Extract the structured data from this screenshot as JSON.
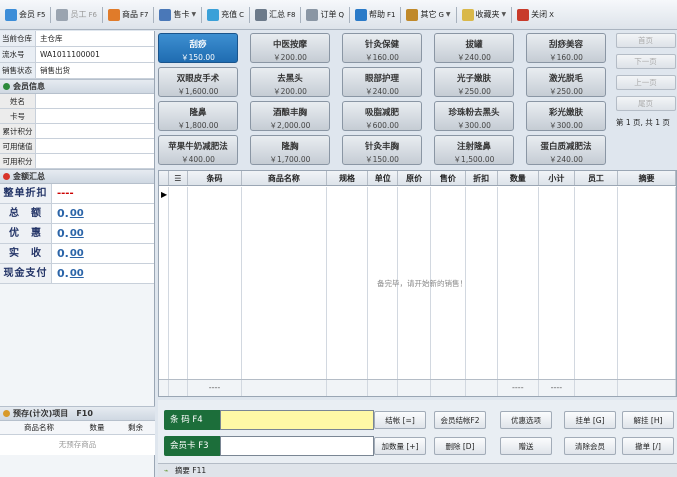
{
  "toolbar": {
    "items": [
      {
        "label": "会员",
        "key": "F5",
        "icon": "member-icon",
        "color": "#3c8dd8",
        "arrow": false,
        "disabled": false
      },
      {
        "label": "员工",
        "key": "F6",
        "icon": "staff-icon",
        "color": "#9aa4b0",
        "arrow": false,
        "disabled": true
      },
      {
        "label": "商品",
        "key": "F7",
        "icon": "goods-icon",
        "color": "#e07b2a",
        "arrow": false,
        "disabled": false
      },
      {
        "label": "售卡",
        "key": "",
        "icon": "sell-card-icon",
        "color": "#4a78b8",
        "arrow": true,
        "disabled": false
      },
      {
        "label": "充值",
        "key": "C",
        "icon": "recharge-icon",
        "color": "#3aa0d8",
        "arrow": false,
        "disabled": false
      },
      {
        "label": "汇总",
        "key": "F8",
        "icon": "summary-icon",
        "color": "#6c7a8a",
        "arrow": false,
        "disabled": false
      },
      {
        "label": "订单",
        "key": "Q",
        "icon": "order-icon",
        "color": "#8a96a4",
        "arrow": false,
        "disabled": false
      },
      {
        "label": "帮助",
        "key": "F1",
        "icon": "help-icon",
        "color": "#2a7ac8",
        "arrow": false,
        "disabled": false
      },
      {
        "label": "其它",
        "key": "G",
        "icon": "other-icon",
        "color": "#c0892a",
        "arrow": true,
        "disabled": false
      },
      {
        "label": "收藏夹",
        "key": "",
        "icon": "favorites-icon",
        "color": "#d9b84a",
        "arrow": true,
        "disabled": false
      },
      {
        "label": "关闭",
        "key": "X",
        "icon": "close-icon",
        "color": "#c83a2a",
        "arrow": false,
        "disabled": false
      }
    ]
  },
  "store": {
    "rows": [
      {
        "label": "当前仓库",
        "value": "主仓库"
      },
      {
        "label": "流水号",
        "value": "WA1011100001"
      },
      {
        "label": "销售状态",
        "value": "销售出货"
      }
    ]
  },
  "member": {
    "title": "会员信息",
    "mark_color": "#2c8a3c",
    "rows": [
      "姓名",
      "卡号",
      "累计积分",
      "可用储值",
      "可用积分"
    ]
  },
  "amounts": {
    "title": "金额汇总",
    "mark_color": "#d8342a",
    "rows": [
      {
        "label": "整单折扣",
        "int": "----",
        "dec": "",
        "is_discount": true
      },
      {
        "label": "总　额",
        "int": "0.",
        "dec": "00",
        "is_discount": false
      },
      {
        "label": "优　惠",
        "int": "0.",
        "dec": "00",
        "is_discount": false
      },
      {
        "label": "实　收",
        "int": "0.",
        "dec": "00",
        "is_discount": false
      },
      {
        "label": "现金支付",
        "int": "0.",
        "dec": "00",
        "is_discount": false
      }
    ]
  },
  "preorder": {
    "title": "预存(计次)项目",
    "key": "F10",
    "columns": [
      "商品名称",
      "数量",
      "剩余"
    ],
    "empty": "无预存商品"
  },
  "services": [
    {
      "name": "刮痧",
      "price": "￥150.00",
      "active": true
    },
    {
      "name": "中医按摩",
      "price": "￥200.00",
      "active": false
    },
    {
      "name": "针灸保健",
      "price": "￥160.00",
      "active": false
    },
    {
      "name": "拔罐",
      "price": "￥240.00",
      "active": false
    },
    {
      "name": "刮痧美容",
      "price": "￥160.00",
      "active": false
    },
    {
      "name": "双眼皮手术",
      "price": "￥1,600.00",
      "active": false
    },
    {
      "name": "去黑头",
      "price": "￥200.00",
      "active": false
    },
    {
      "name": "眼部护理",
      "price": "￥240.00",
      "active": false
    },
    {
      "name": "光子嫩肤",
      "price": "￥250.00",
      "active": false
    },
    {
      "name": "激光脱毛",
      "price": "￥250.00",
      "active": false
    },
    {
      "name": "隆鼻",
      "price": "￥1,800.00",
      "active": false
    },
    {
      "name": "酒酿丰胸",
      "price": "￥2,000.00",
      "active": false
    },
    {
      "name": "吸脂减肥",
      "price": "￥600.00",
      "active": false
    },
    {
      "name": "珍珠粉去黑头",
      "price": "￥300.00",
      "active": false
    },
    {
      "name": "彩光嫩肤",
      "price": "￥300.00",
      "active": false
    },
    {
      "name": "苹果牛奶减肥法",
      "price": "￥400.00",
      "active": false
    },
    {
      "name": "隆胸",
      "price": "￥1,700.00",
      "active": false
    },
    {
      "name": "针灸丰胸",
      "price": "￥150.00",
      "active": false
    },
    {
      "name": "注射隆鼻",
      "price": "￥1,500.00",
      "active": false
    },
    {
      "name": "蛋白质减肥法",
      "price": "￥240.00",
      "active": false
    }
  ],
  "pager": {
    "buttons": [
      "首页",
      "下一页",
      "上一页",
      "尾页"
    ],
    "info": "第 1 页, 共 1 页"
  },
  "table": {
    "columns": [
      "☰",
      "条码",
      "商品名称",
      "规格",
      "单位",
      "原价",
      "售价",
      "折扣",
      "数量",
      "小计",
      "员工",
      "摘要"
    ],
    "footer": [
      "",
      "----",
      "",
      "",
      "",
      "",
      "",
      "",
      "----",
      "----",
      "",
      ""
    ],
    "empty_message": "备完毕，请开始新的销售！"
  },
  "entry": {
    "barcode_label": "条 码 F4",
    "member_label": "会员卡 F3",
    "barcode_color": "#fff9a6"
  },
  "actions": [
    {
      "label": "结帐 [=]"
    },
    {
      "label": "会员结帐F2"
    },
    {
      "label": "优惠选项"
    },
    {
      "label": "挂单 [G]"
    },
    {
      "label": "解挂 [H]"
    },
    {
      "label": "加数量 [+]"
    },
    {
      "label": "删除 [D]"
    },
    {
      "label": "赠送"
    },
    {
      "label": "清除会员"
    },
    {
      "label": "撤单 [/]"
    }
  ],
  "status": {
    "text": "摘要 F11"
  }
}
